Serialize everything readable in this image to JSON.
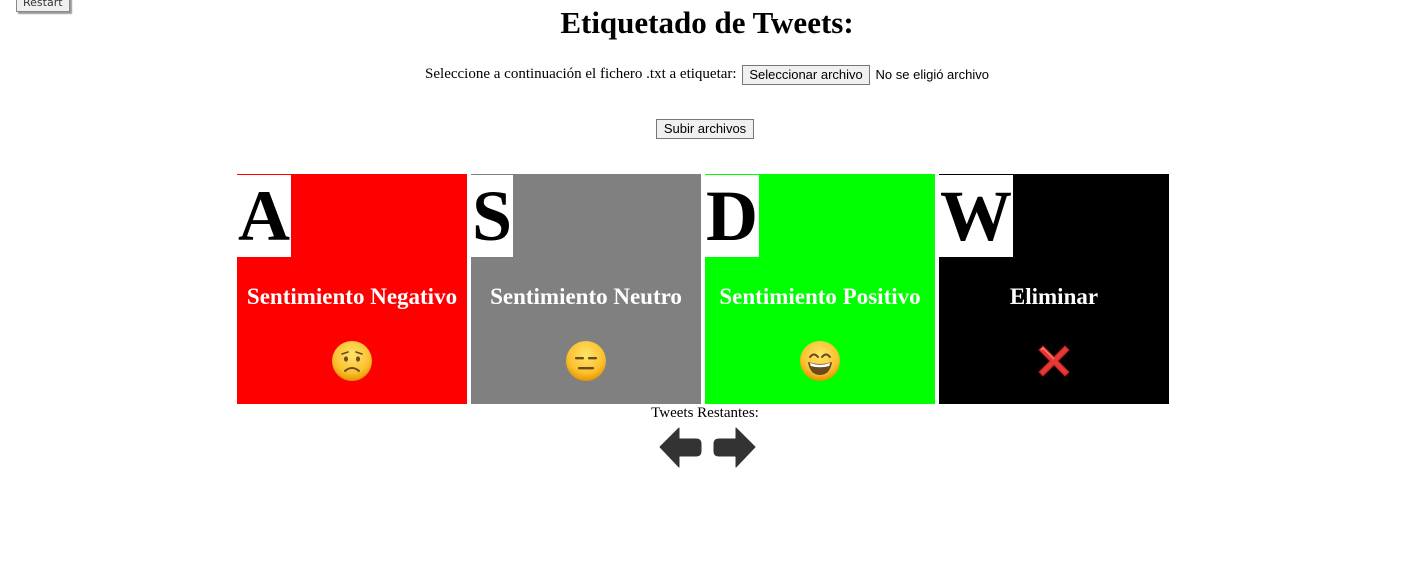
{
  "restart_label": "Restart",
  "title": "Etiquetado de Tweets:",
  "file_select": {
    "prompt": "Seleccione a continuación el fichero .txt a etiquetar:",
    "button_label": "Seleccionar archivo",
    "status": "No se eligió archivo"
  },
  "upload_label": "Subir archivos",
  "cards": [
    {
      "key": "A",
      "label": "Sentimiento Negativo",
      "color": "#ff0000",
      "icon": "frowning-face-icon"
    },
    {
      "key": "S",
      "label": "Sentimiento Neutro",
      "color": "#808080",
      "icon": "expressionless-face-icon"
    },
    {
      "key": "D",
      "label": "Sentimiento Positivo",
      "color": "#00ff00",
      "icon": "grinning-face-icon"
    },
    {
      "key": "W",
      "label": "Eliminar",
      "color": "#000000",
      "icon": "cross-mark-icon"
    }
  ],
  "tweets_remaining_label": "Tweets Restantes:",
  "nav": {
    "prev_icon": "arrow-left-icon",
    "next_icon": "arrow-right-icon",
    "arrow_color": "#333333"
  }
}
